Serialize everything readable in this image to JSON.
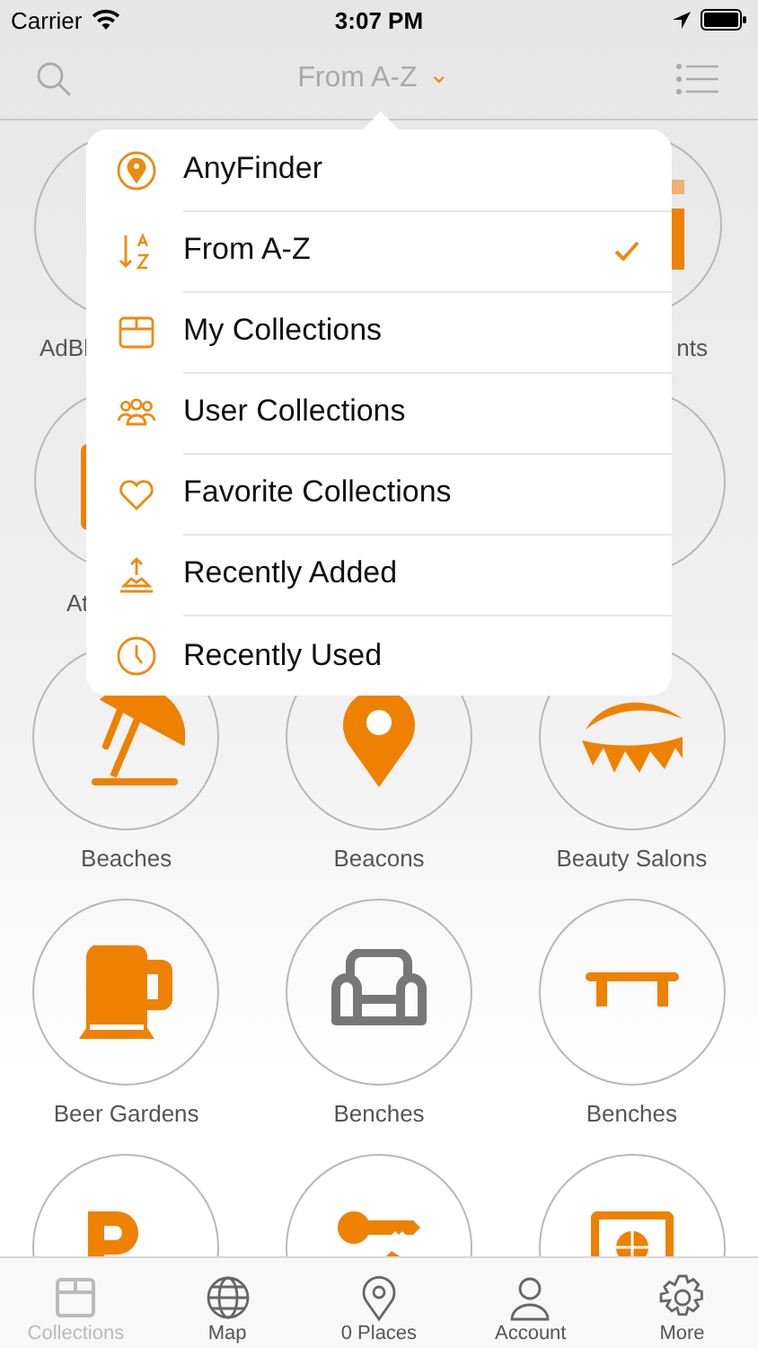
{
  "status_bar": {
    "carrier": "Carrier",
    "time": "3:07 PM"
  },
  "nav_bar": {
    "title": "From A-Z",
    "chevron": "⌄"
  },
  "grid": {
    "rows": [
      {
        "cells": [
          {
            "kind": "blank",
            "label": "AdBl"
          },
          {
            "kind": "bars",
            "label": "nts"
          }
        ]
      },
      {
        "cells": [
          {
            "kind": "block",
            "label": "At"
          },
          {
            "kind": "blank"
          }
        ]
      },
      {
        "cells": [
          {
            "kind": "umbrella",
            "label": "Beaches"
          },
          {
            "kind": "pin",
            "label": "Beacons"
          },
          {
            "kind": "lash",
            "label": "Beauty Salons"
          }
        ]
      },
      {
        "cells": [
          {
            "kind": "mug",
            "label": "Beer Gardens"
          },
          {
            "kind": "armchair",
            "label": "Benches"
          },
          {
            "kind": "bench",
            "label": "Benches"
          }
        ]
      },
      {
        "cells": [
          {
            "kind": "parking"
          },
          {
            "kind": "key"
          },
          {
            "kind": "safe"
          }
        ]
      }
    ]
  },
  "menu": {
    "items": [
      {
        "kind": "pin",
        "label": "AnyFinder",
        "selected": false
      },
      {
        "kind": "sort",
        "label": "From A-Z",
        "selected": true
      },
      {
        "kind": "box",
        "label": "My Collections",
        "selected": false
      },
      {
        "kind": "people",
        "label": "User Collections",
        "selected": false
      },
      {
        "kind": "heart",
        "label": "Favorite Collections",
        "selected": false
      },
      {
        "kind": "added",
        "label": "Recently Added",
        "selected": false
      },
      {
        "kind": "clock",
        "label": "Recently Used",
        "selected": false
      }
    ]
  },
  "tab_bar": {
    "items": [
      {
        "kind": "box",
        "label": "Collections",
        "disabled": true
      },
      {
        "kind": "globe",
        "label": "Map",
        "disabled": false
      },
      {
        "kind": "pin",
        "label": "0 Places",
        "disabled": false
      },
      {
        "kind": "person",
        "label": "Account",
        "disabled": false
      },
      {
        "kind": "gear",
        "label": "More",
        "disabled": false
      }
    ]
  }
}
